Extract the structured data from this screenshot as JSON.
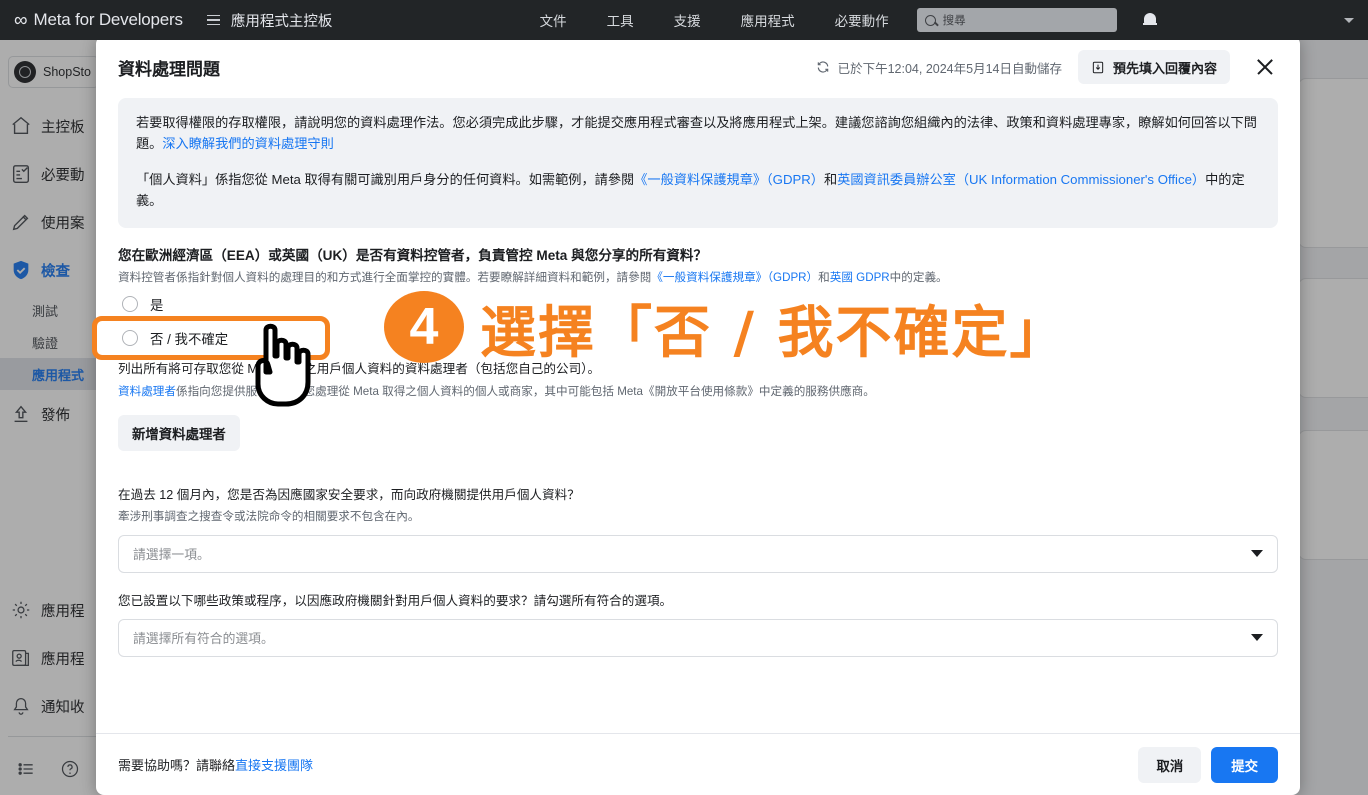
{
  "topnav": {
    "brand_mark": "∞",
    "brand": "Meta for Developers",
    "menu_label": "應用程式主控板",
    "links": [
      "文件",
      "工具",
      "支援",
      "應用程式",
      "必要動作"
    ],
    "search_placeholder": "搜尋",
    "icons": {
      "hamburger": "hamburger-icon",
      "search": "search-icon",
      "bell": "notification-bell-icon",
      "caret": "chevron-down-icon"
    }
  },
  "sidebar": {
    "app_name": "ShopSto",
    "items": [
      {
        "label": "主控板",
        "icon": "home-icon"
      },
      {
        "label": "必要動",
        "icon": "checklist-icon"
      },
      {
        "label": "使用案",
        "icon": "pencil-icon"
      },
      {
        "label": "檢查",
        "icon": "shield-check-icon",
        "active": true
      }
    ],
    "sub_items": [
      {
        "label": "測試",
        "selected": false
      },
      {
        "label": "驗證",
        "selected": false
      },
      {
        "label": "應用程式",
        "selected": true
      }
    ],
    "publish": {
      "label": "發佈",
      "icon": "upload-icon"
    },
    "bottom_items": [
      {
        "label": "應用程",
        "icon": "gear-icon"
      },
      {
        "label": "應用程",
        "icon": "app-roles-icon"
      },
      {
        "label": "通知收",
        "icon": "bell-icon"
      }
    ],
    "footer_icons": [
      "list-icon",
      "help-circle-icon"
    ]
  },
  "modal": {
    "title": "資料處理問題",
    "autosave": "已於下午12:04, 2024年5月14日自動儲存",
    "autosave_icon": "refresh-icon",
    "prefill_button": "預先填入回覆內容",
    "prefill_icon": "import-icon",
    "close_icon": "close-icon",
    "info": {
      "p1_a": "若要取得權限的存取權限，請說明您的資料處理作法。您必須完成此步驟，才能提交應用程式審查以及將應用程式上架。建議您諮詢您組織內的法律、政策和資料處理專家，瞭解如何回答以下問題。",
      "p1_link": "深入瞭解我們的資料處理守則",
      "p2_a": "「個人資料」係指您從 Meta 取得有關可識別用戶身分的任何資料。如需範例，請參閱",
      "p2_link1": "《一般資料保護規章》（GDPR）",
      "p2_mid": "和",
      "p2_link2": "英國資訊委員辦公室（UK Information Commissioner's Office）",
      "p2_end": "中的定義。"
    },
    "q1": {
      "title": "您在歐洲經濟區（EEA）或英國（UK）是否有資料控管者，負責管控 Meta 與您分享的所有資料？",
      "link1": "歐洲經濟區",
      "link2": "英國",
      "sub_a": "資料控管者係指針對個人資料的處理目的和方式進行全面掌控的實體。若要瞭解詳細資料和範例，請參閱",
      "sub_link1": "《一般資料保護規章》（GDPR）",
      "sub_mid": "和",
      "sub_link2": "英國 GDPR",
      "sub_end": "中的定義。",
      "options": [
        {
          "label": "是",
          "selected": false
        },
        {
          "label": "否 / 我不確定",
          "selected": false
        }
      ]
    },
    "q2": {
      "title": "列出所有將可存取您從 Meta 取得之用戶個人資料的資料處理者（包括您自己的公司）。",
      "sub_link": "資料處理者",
      "sub_rest": "係指向您提供服務或協助您處理從 Meta 取得之個人資料的個人或商家，其中可能包括 Meta《開放平台使用條款》中定義的服務供應商。",
      "add_button": "新增資料處理者"
    },
    "q3": {
      "title": "在過去 12 個月內，您是否為因應國家安全要求，而向政府機關提供用戶個人資料？",
      "sub": "牽涉刑事調查之搜查令或法院命令的相關要求不包含在內。",
      "select_placeholder": "請選擇一項。"
    },
    "q4": {
      "title": "您已設置以下哪些政策或程序，以因應政府機關針對用戶個人資料的要求？請勾選所有符合的選項。",
      "select_placeholder": "請選擇所有符合的選項。"
    },
    "footer": {
      "help_text": "需要協助嗎？請聯絡",
      "help_link": "直接支援團隊",
      "cancel": "取消",
      "submit": "提交"
    }
  },
  "annotation": {
    "step_number": "4",
    "text": "選擇「否 / 我不確定」",
    "color": "#f58220",
    "cursor_icon": "pointing-hand-cursor"
  }
}
